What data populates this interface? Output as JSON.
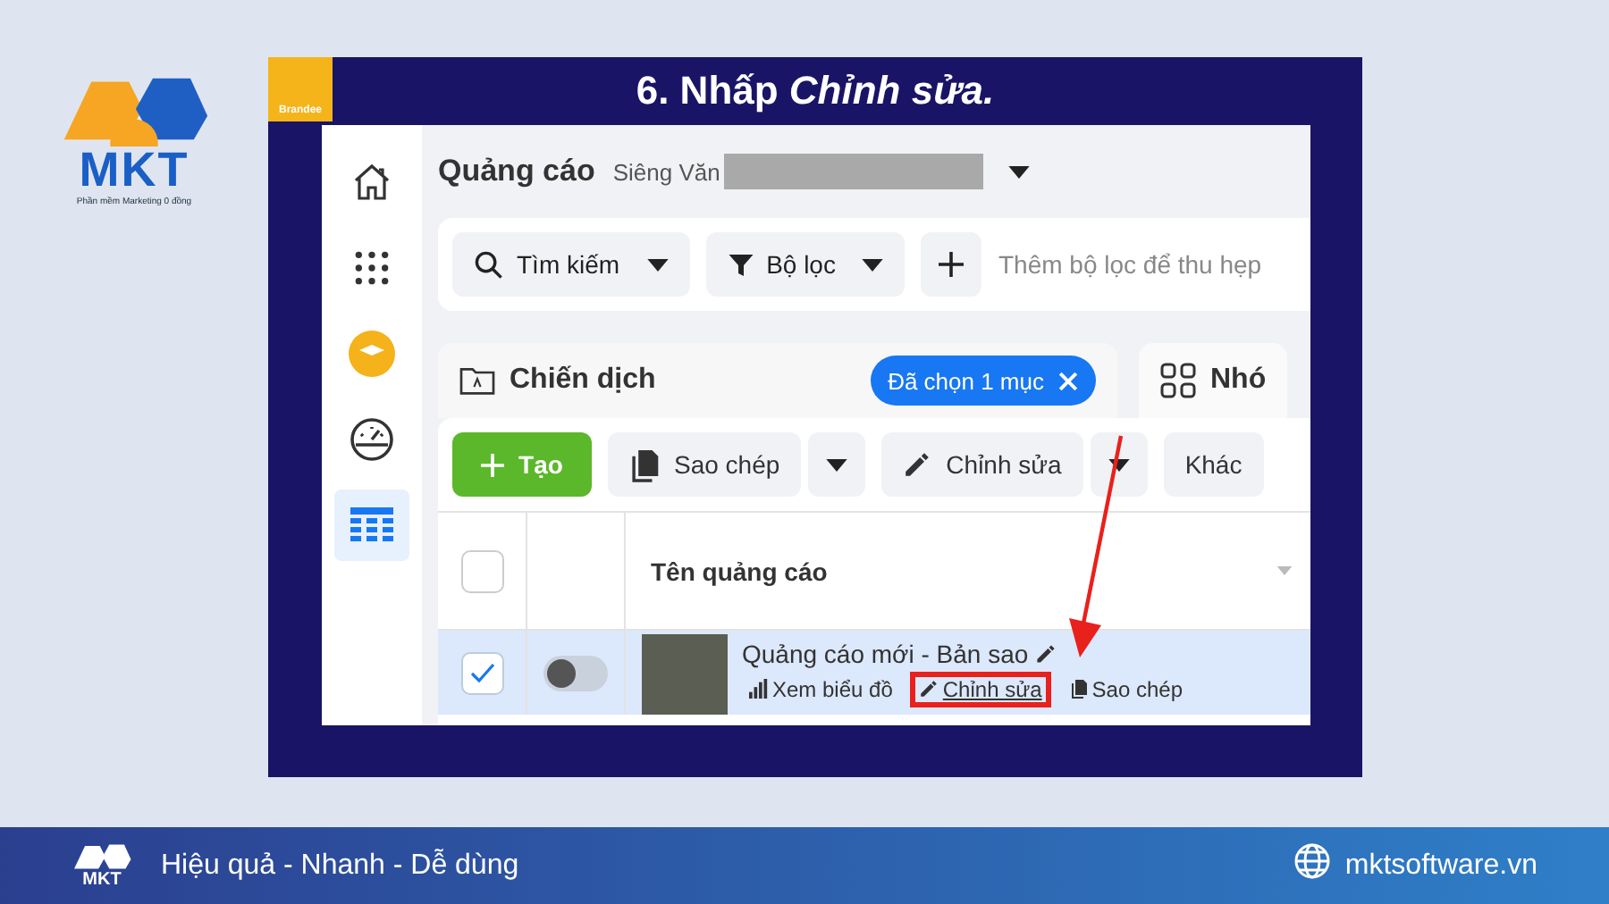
{
  "logo": {
    "mark": "MKT",
    "tagline": "Phần mềm Marketing 0 đồng"
  },
  "slide": {
    "badge": "Brandee",
    "title": "6. Nhấp *Chỉnh sửa.*"
  },
  "app": {
    "nav": [
      {
        "selected": false
      },
      {
        "selected": false
      },
      {
        "selected": false
      },
      {
        "selected": false
      },
      {
        "selected": true
      }
    ],
    "header": {
      "title": "Quảng cáo",
      "account": "Siêng Văn"
    },
    "filters": [
      {
        "kind": "dropdown",
        "label": "Tìm kiếm"
      },
      {
        "kind": "dropdown",
        "label": "Bộ lọc"
      },
      {
        "kind": "add",
        "placeholder": "Thêm bộ lọc để thu hẹp"
      }
    ],
    "tabs": [
      {
        "label": "Chiến dịch",
        "selected": true,
        "chip": "Đã chọn 1 mục"
      },
      {
        "label": "Nhó",
        "selected": false
      }
    ],
    "actions": [
      {
        "kind": "primary",
        "label": "Tạo"
      },
      {
        "kind": "split",
        "label": "Sao chép"
      },
      {
        "kind": "split",
        "label": "Chỉnh sửa"
      },
      {
        "kind": "plain",
        "label": "Khác"
      }
    ],
    "table": {
      "header_checked": false,
      "column": "Tên quảng cáo",
      "rows": [
        {
          "checked": true,
          "on": false,
          "selected": true,
          "name": "Quảng cáo mới - Bản sao",
          "links": [
            {
              "label": "Xem biểu đồ",
              "highlighted": false
            },
            {
              "label": "Chỉnh sửa",
              "highlighted": true
            },
            {
              "label": "Sao chép",
              "highlighted": false
            }
          ]
        }
      ]
    }
  },
  "footer": {
    "mark": "MKT",
    "slogan": "Hiệu quả - Nhanh - Dễ dùng",
    "website": "mktsoftware.vn"
  }
}
